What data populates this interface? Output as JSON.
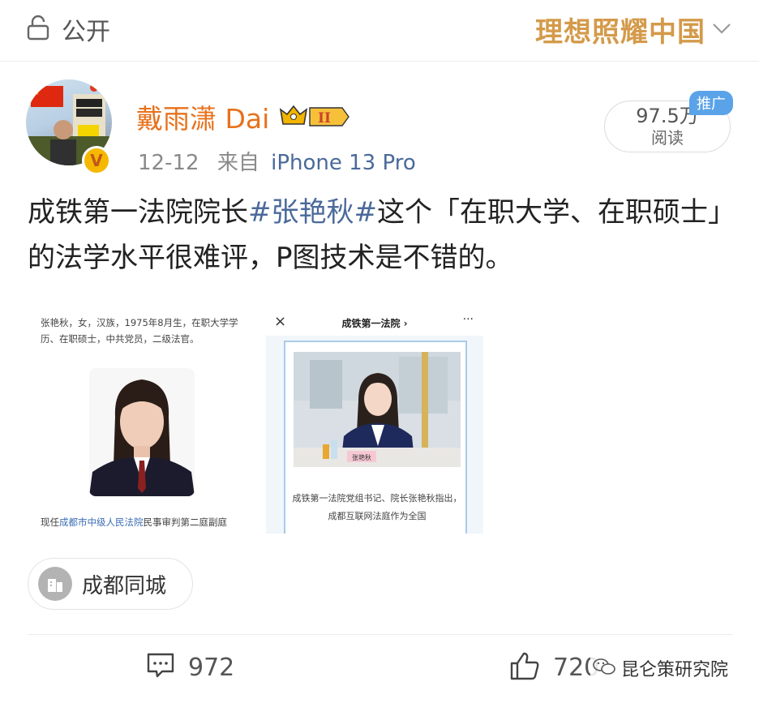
{
  "header": {
    "visibility_label": "公开",
    "banner_text": "理想照耀中国"
  },
  "post": {
    "author_name": "戴雨潇 Dai",
    "level_badge": "II",
    "verified_badge": "V",
    "date": "12-12",
    "source_prefix": "来自",
    "device": "iPhone 13 Pro",
    "reads_count": "97.5万",
    "reads_label": "阅读",
    "promoted_tag": "推广",
    "text_part1": "成铁第一法院院长",
    "hashtag": "#张艳秋#",
    "text_part2": "这个「在职大学、在职硕士」的法学水平很难评，P图技术是不错的。"
  },
  "images": {
    "left": {
      "bio_text": "张艳秋，女，汉族，1975年8月生，在职大学学历、在职硕士，中共党员，二级法官。",
      "footer_prefix": "现任",
      "footer_link": "成都市中级人民法院",
      "footer_suffix": "民事审判第二庭副庭"
    },
    "right": {
      "close_icon": "×",
      "title": "成铁第一法院 ›",
      "more_icon": "···",
      "nameplate": "张艳秋",
      "caption": "成铁第一法院党组书记、院长张艳秋指出，成都互联网法庭作为全国"
    }
  },
  "location": {
    "label": "成都同城"
  },
  "actions": {
    "comment_count": "972",
    "like_count": "720"
  },
  "watermark": {
    "text": "昆仑策研究院"
  },
  "colors": {
    "author": "#e8711b",
    "link": "#4a6a9a",
    "banner": "#d49a4a",
    "promoted": "#5aa3e8"
  }
}
